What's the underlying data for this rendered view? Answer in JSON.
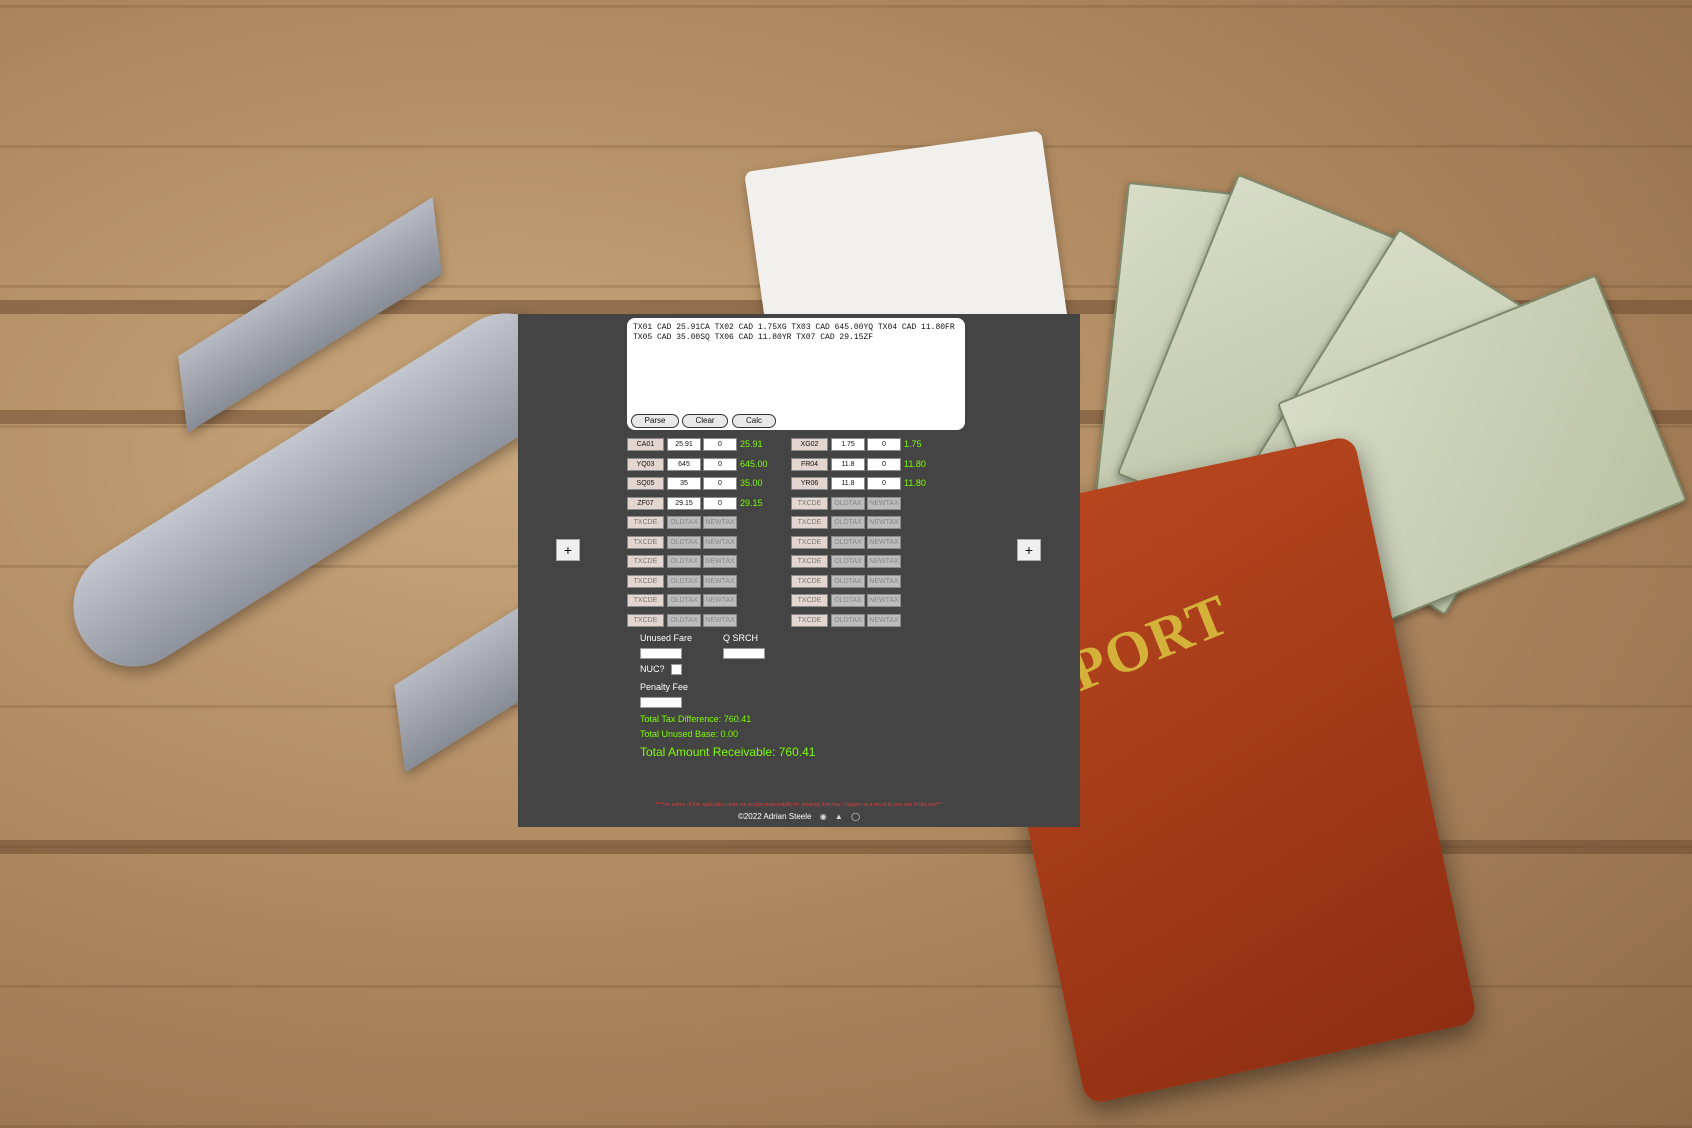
{
  "parser": {
    "input_text": "TX01 CAD 25.91CA TX02 CAD 1.75XG TX03 CAD 645.00YQ TX04 CAD 11.80FR TX05 CAD 35.00SQ TX06 CAD 11.80YR TX07 CAD 29.15ZF",
    "parse_label": "Parse",
    "clear_label": "Clear",
    "calc_label": "Calc"
  },
  "add_label": "+",
  "left_rows": [
    {
      "code": "CA01",
      "old": "25.91",
      "new": "0",
      "diff": "25.91"
    },
    {
      "code": "YQ03",
      "old": "645",
      "new": "0",
      "diff": "645.00"
    },
    {
      "code": "SQ05",
      "old": "35",
      "new": "0",
      "diff": "35.00"
    },
    {
      "code": "ZF07",
      "old": "29.15",
      "new": "0",
      "diff": "29.15"
    },
    {
      "code": "TXCDE",
      "old": "OLDTAX",
      "new": "NEWTAX",
      "diff": ""
    },
    {
      "code": "TXCDE",
      "old": "OLDTAX",
      "new": "NEWTAX",
      "diff": ""
    },
    {
      "code": "TXCDE",
      "old": "OLDTAX",
      "new": "NEWTAX",
      "diff": ""
    },
    {
      "code": "TXCDE",
      "old": "OLDTAX",
      "new": "NEWTAX",
      "diff": ""
    },
    {
      "code": "TXCDE",
      "old": "OLDTAX",
      "new": "NEWTAX",
      "diff": ""
    },
    {
      "code": "TXCDE",
      "old": "OLDTAX",
      "new": "NEWTAX",
      "diff": ""
    }
  ],
  "right_rows": [
    {
      "code": "XG02",
      "old": "1.75",
      "new": "0",
      "diff": "1.75"
    },
    {
      "code": "FR04",
      "old": "11.8",
      "new": "0",
      "diff": "11.80"
    },
    {
      "code": "YR06",
      "old": "11.8",
      "new": "0",
      "diff": "11.80"
    },
    {
      "code": "TXCDE",
      "old": "OLDTAX",
      "new": "NEWTAX",
      "diff": ""
    },
    {
      "code": "TXCDE",
      "old": "OLDTAX",
      "new": "NEWTAX",
      "diff": ""
    },
    {
      "code": "TXCDE",
      "old": "OLDTAX",
      "new": "NEWTAX",
      "diff": ""
    },
    {
      "code": "TXCDE",
      "old": "OLDTAX",
      "new": "NEWTAX",
      "diff": ""
    },
    {
      "code": "TXCDE",
      "old": "OLDTAX",
      "new": "NEWTAX",
      "diff": ""
    },
    {
      "code": "TXCDE",
      "old": "OLDTAX",
      "new": "NEWTAX",
      "diff": ""
    },
    {
      "code": "TXCDE",
      "old": "OLDTAX",
      "new": "NEWTAX",
      "diff": ""
    }
  ],
  "form": {
    "unused_fare_label": "Unused Fare",
    "q_srch_label": "Q SRCH",
    "nuc_label": "NUC?",
    "penalty_fee_label": "Penalty Fee"
  },
  "totals": {
    "tax_difference": "Total Tax Difference: 760.41",
    "unused_base": "Total Unused Base: 0.00",
    "amount_receivable": "Total Amount Receivable: 760.41"
  },
  "footer": {
    "disclaimer": "***The author of this application does not accept responsibility for anything that may / happen as a result of your use of this tool***",
    "copyright": "©2022 Adrian Steele",
    "icons": [
      "github-icon",
      "flame-icon",
      "coffee-icon"
    ]
  },
  "colors": {
    "panel_bg": "#444444",
    "value_green": "#7cfc00",
    "disclaimer_red": "#e03a3a"
  }
}
